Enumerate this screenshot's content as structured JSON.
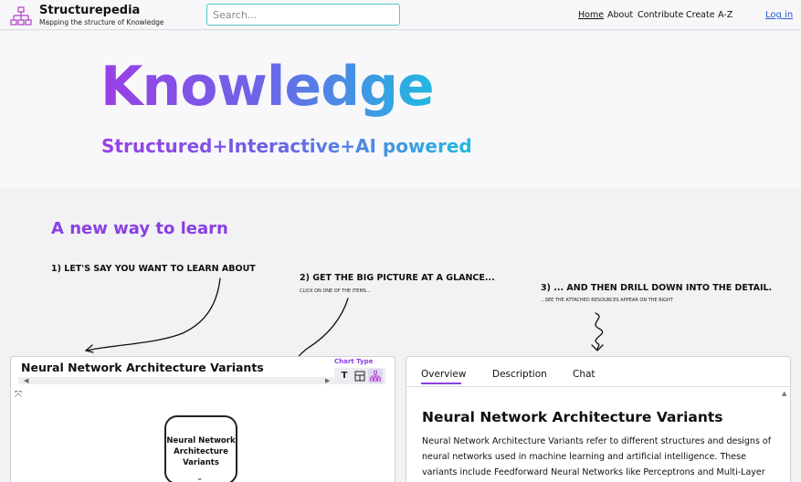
{
  "header": {
    "brand_name": "Structurepedia",
    "brand_tagline": "Mapping the structure of Knowledge",
    "search_placeholder": "Search...",
    "nav": [
      "Home",
      "About",
      "Contribute",
      "Create",
      "A-Z"
    ],
    "login": "Log in",
    "logo_icon": "hierarchy-icon"
  },
  "hero": {
    "title": "Knowledge",
    "subtitle": "Structured+Interactive+AI powered"
  },
  "learn": {
    "title": "A new way to learn",
    "step1": "1) LET'S SAY YOU WANT TO LEARN ABOUT",
    "step2": "2) GET THE BIG PICTURE AT A GLANCE...",
    "step2_sub": "CLICK ON ONE OF THE ITEMS...",
    "step3": "3) ... AND THEN DRILL DOWN INTO THE DETAIL.",
    "step3_sub": "...SEE THE ATTACHED RESOURCES APPEAR ON THE RIGHT"
  },
  "left_panel": {
    "title": "Neural Network Architecture Variants",
    "chart_type_label": "Chart Type",
    "chart_type_text": "T",
    "chart_type_grid_icon": "grid-icon",
    "chart_type_tree_icon": "tree-icon",
    "node_label": "Neural Network Architecture Variants"
  },
  "right_panel": {
    "tabs": [
      "Overview",
      "Description",
      "Chat"
    ],
    "active_tab": "Overview",
    "heading": "Neural Network Architecture Variants",
    "body": "Neural Network Architecture Variants refer to different structures and designs of neural networks used in machine learning and artificial intelligence. These variants include Feedforward Neural Networks like Perceptrons and Multi-Layer"
  },
  "colors": {
    "accent": "#8a3fe3",
    "gradient_start": "#9b3ee6",
    "gradient_end": "#22b9e0",
    "link": "#2a5bd7"
  }
}
